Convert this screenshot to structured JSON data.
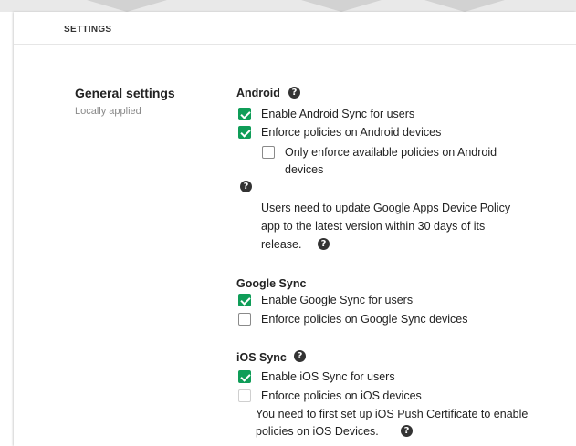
{
  "card": {
    "header": "SETTINGS"
  },
  "general": {
    "title": "General settings",
    "subtitle": "Locally applied"
  },
  "android": {
    "heading": "Android",
    "enable_sync": {
      "label": "Enable Android Sync for users",
      "checked": true
    },
    "enforce_policies": {
      "label": "Enforce policies on Android devices",
      "checked": true
    },
    "only_available": {
      "label_line1": "Only enforce available policies on Android",
      "label_line2": "devices",
      "checked": false
    },
    "note_line1": "Users need to update Google Apps Device Policy",
    "note_line2": "app to the latest version within 30 days of its",
    "note_line3": "release."
  },
  "google_sync": {
    "heading": "Google Sync",
    "enable_sync": {
      "label": "Enable Google Sync for users",
      "checked": true
    },
    "enforce_policies": {
      "label": "Enforce policies on Google Sync devices",
      "checked": false
    }
  },
  "ios_sync": {
    "heading": "iOS Sync",
    "enable_sync": {
      "label": "Enable iOS Sync for users",
      "checked": true
    },
    "enforce_policies": {
      "label": "Enforce policies on iOS devices",
      "checked": false,
      "disabled": true
    },
    "note_line1": "You need to first set up iOS Push Certificate to enable",
    "note_line2": "policies on iOS Devices."
  },
  "icons": {
    "help": "help-icon",
    "check": "checkmark-icon"
  },
  "colors": {
    "checkbox_checked": "#0f9d58",
    "help_icon": "#333333"
  }
}
